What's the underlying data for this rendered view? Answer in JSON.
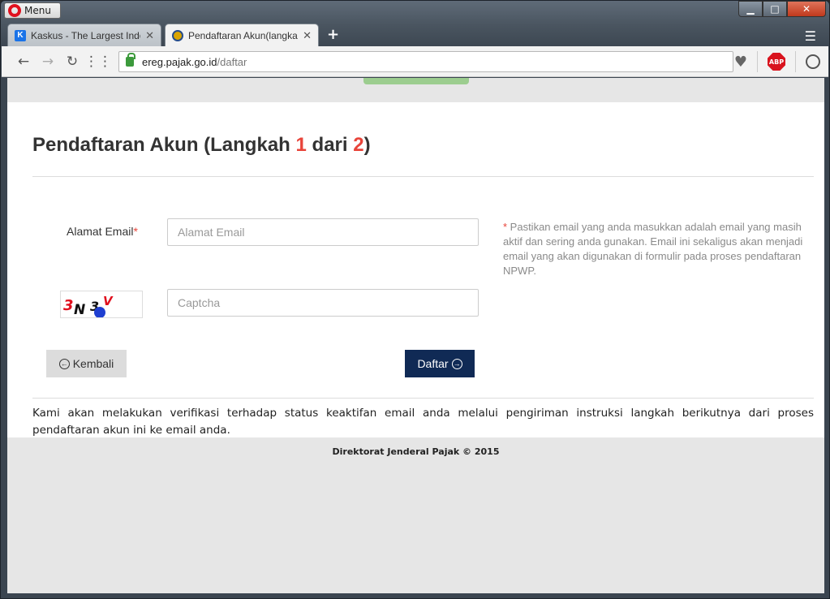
{
  "window": {
    "menu_label": "Menu",
    "min_glyph": "▁",
    "max_glyph": "□",
    "close_glyph": "✕"
  },
  "tabs": [
    {
      "label": "Kaskus - The Largest Indo",
      "icon": "kaskus-favicon",
      "close": "✕"
    },
    {
      "label": "Pendaftaran Akun(langkah",
      "icon": "djp-favicon",
      "close": "✕",
      "active": true
    }
  ],
  "new_tab_glyph": "+",
  "toolbar": {
    "back": "←",
    "forward": "→",
    "reload": "↻",
    "speed_dial": "⋮⋮",
    "url_domain": "ereg.pajak.go.id",
    "url_path": "/daftar",
    "heart": "♥",
    "abp_label": "ABP"
  },
  "page": {
    "title_prefix": "Pendaftaran Akun  (Langkah ",
    "step_current": "1",
    "title_middle": " dari ",
    "step_total": "2",
    "title_suffix": ")",
    "email_label": "Alamat Email",
    "required_mark": "*",
    "email_placeholder": "Alamat Email",
    "captcha_placeholder": "Captcha",
    "captcha_text": "3N3V",
    "hint_mark": "*",
    "hint_text": " Pastikan email yang anda masukkan adalah email yang masih aktif dan sering anda gunakan. Email ini sekaligus akan menjadi email yang akan digunakan di formulir pada proses pendaftaran NPWP.",
    "back_label": "Kembali",
    "submit_label": "Daftar",
    "info_text": "Kami akan melakukan verifikasi terhadap status keaktifan email anda melalui pengiriman instruksi langkah berikutnya dari proses pendaftaran akun ini ke email anda.",
    "footer": "Direktorat Jenderal Pajak © 2015"
  },
  "colors": {
    "accent_red": "#e8443a",
    "submit_bg": "#102a55",
    "secure_green": "#3c9a3c"
  }
}
